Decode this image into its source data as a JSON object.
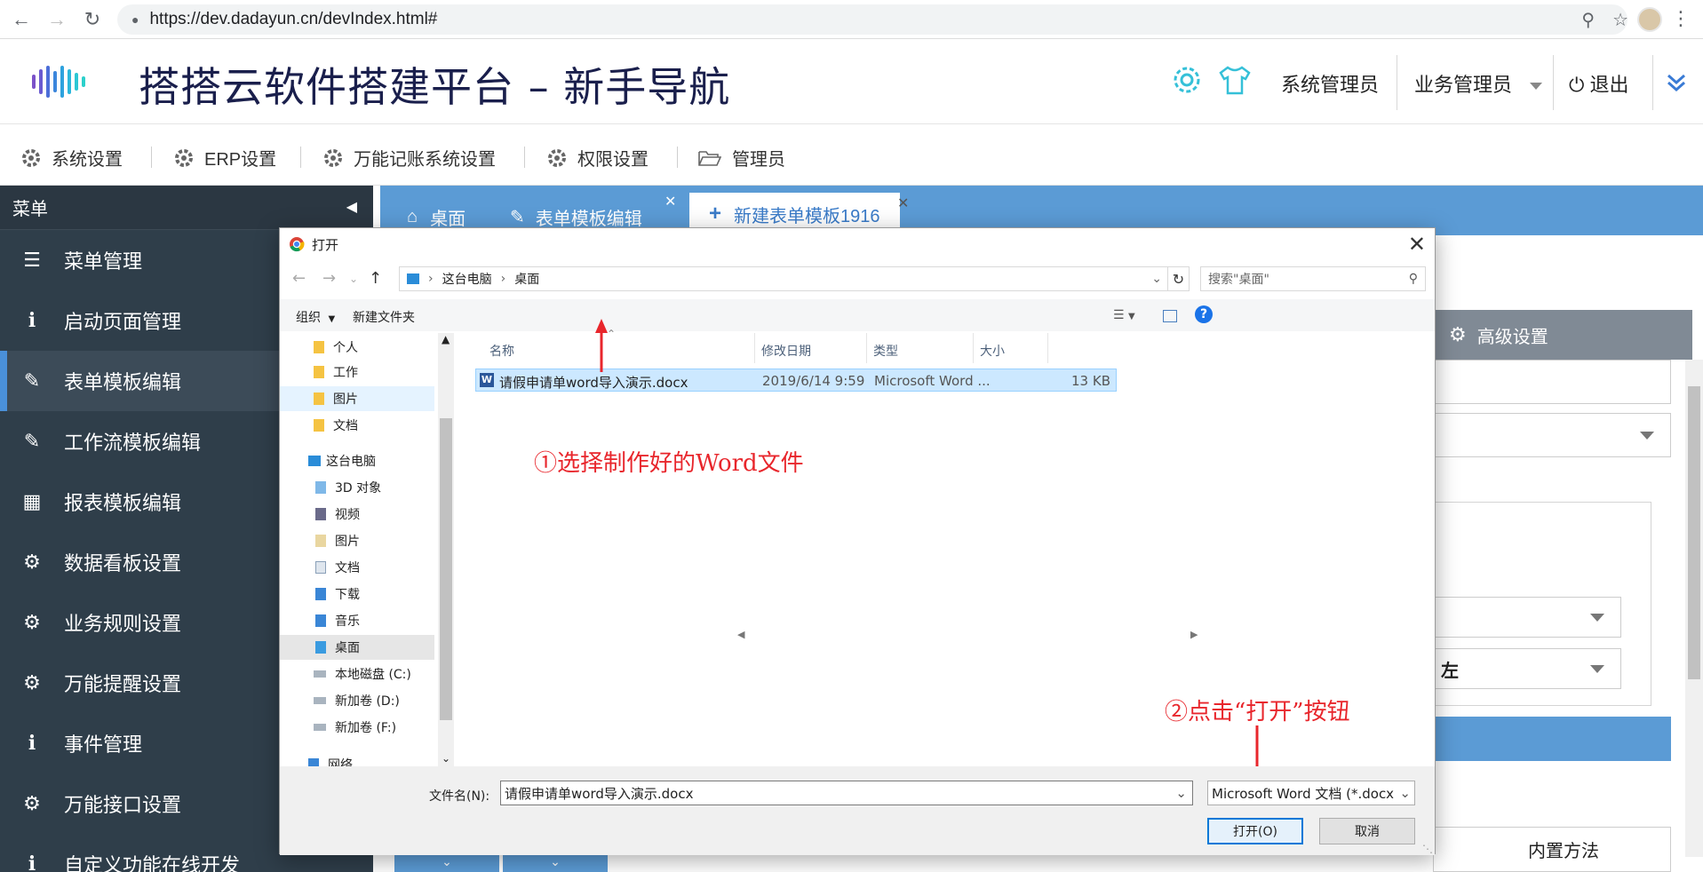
{
  "browser": {
    "url": "https://dev.dadayun.cn/devIndex.html#"
  },
  "header": {
    "title": "搭搭云软件搭建平台 – 新手导航",
    "user_system": "系统管理员",
    "user_business": "业务管理员",
    "logout": "退出"
  },
  "modules": [
    "系统设置",
    "ERP设置",
    "万能记账系统设置",
    "权限设置",
    "管理员"
  ],
  "sidebar": {
    "title": "菜单",
    "items": [
      {
        "label": "菜单管理",
        "icon": "list-icon"
      },
      {
        "label": "启动页面管理",
        "icon": "info-icon"
      },
      {
        "label": "表单模板编辑",
        "icon": "edit-icon",
        "active": true
      },
      {
        "label": "工作流模板编辑",
        "icon": "edit-icon"
      },
      {
        "label": "报表模板编辑",
        "icon": "table-icon"
      },
      {
        "label": "数据看板设置",
        "icon": "gear-icon"
      },
      {
        "label": "业务规则设置",
        "icon": "gear-icon"
      },
      {
        "label": "万能提醒设置",
        "icon": "gear-icon"
      },
      {
        "label": "事件管理",
        "icon": "info-icon"
      },
      {
        "label": "万能接口设置",
        "icon": "gear-icon"
      },
      {
        "label": "自定义功能在线开发",
        "icon": "info-icon"
      }
    ]
  },
  "content_tabs": [
    {
      "label": "桌面"
    },
    {
      "label": "表单模板编辑"
    },
    {
      "label": "新建表单模板1916",
      "active": true
    }
  ],
  "right_panel": {
    "advanced_settings": "高级设置",
    "align_value": "左",
    "builtin_method": "内置方法"
  },
  "dialog": {
    "title": "打开",
    "breadcrumb": [
      "这台电脑",
      "桌面"
    ],
    "search_placeholder": "搜索\"桌面\"",
    "toolbar": {
      "organize": "组织",
      "new_folder": "新建文件夹"
    },
    "nav_items": [
      {
        "label": "个人",
        "type": "folder"
      },
      {
        "label": "工作",
        "type": "folder"
      },
      {
        "label": "图片",
        "type": "folder",
        "highlight": true
      },
      {
        "label": "文档",
        "type": "folder"
      },
      {
        "label": "这台电脑",
        "type": "pc"
      },
      {
        "label": "3D 对象",
        "type": "folder"
      },
      {
        "label": "视频",
        "type": "folder"
      },
      {
        "label": "图片",
        "type": "folder"
      },
      {
        "label": "文档",
        "type": "folder"
      },
      {
        "label": "下载",
        "type": "folder"
      },
      {
        "label": "音乐",
        "type": "folder"
      },
      {
        "label": "桌面",
        "type": "folder",
        "selected": true
      },
      {
        "label": "本地磁盘 (C:)",
        "type": "drive"
      },
      {
        "label": "新加卷 (D:)",
        "type": "drive"
      },
      {
        "label": "新加卷 (F:)",
        "type": "drive"
      },
      {
        "label": "网络",
        "type": "network"
      }
    ],
    "columns": [
      "名称",
      "修改日期",
      "类型",
      "大小"
    ],
    "file": {
      "name": "请假申请单word导入演示.docx",
      "modified": "2019/6/14 9:59",
      "type": "Microsoft Word ...",
      "size": "13 KB"
    },
    "filename_label": "文件名(N):",
    "filename_value": "请假申请单word导入演示.docx",
    "filter": "Microsoft Word 文档 (*.docx",
    "open_button": "打开(O)",
    "cancel_button": "取消"
  },
  "annotations": {
    "step1": "①选择制作好的Word文件",
    "step2": "②点击“打开”按钮"
  },
  "colors": {
    "accent_blue": "#5b9bd5",
    "sidebar_bg": "#2f3e4a",
    "annotation_red": "#e8262c",
    "title_navy": "#1a1f4c"
  }
}
